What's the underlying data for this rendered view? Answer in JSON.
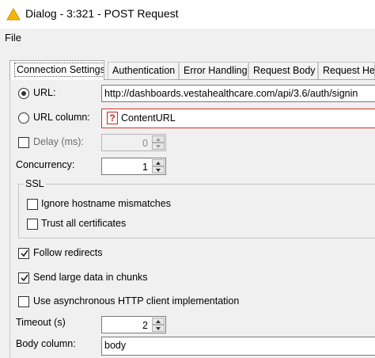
{
  "window": {
    "title": "Dialog - 3:321 - POST Request",
    "icon": "warning-triangle-icon",
    "accent_color": "#f5b800"
  },
  "menu": {
    "file": "File"
  },
  "tabs": [
    {
      "label": "Connection Settings",
      "active": true
    },
    {
      "label": "Authentication",
      "active": false
    },
    {
      "label": "Error Handling",
      "active": false
    },
    {
      "label": "Request Body",
      "active": false
    },
    {
      "label": "Request Hea",
      "active": false
    }
  ],
  "form": {
    "url_label": "URL:",
    "url_value": "http://dashboards.vestahealthcare.com/api/3.6/auth/signin",
    "url_selected": true,
    "url_column_label": "URL column:",
    "url_column_value": "ContentURL",
    "url_column_badge": "?",
    "delay_label": "Delay (ms):",
    "delay_checked": false,
    "delay_value": "0",
    "concurrency_label": "Concurrency:",
    "concurrency_value": "1",
    "ssl_title": "SSL",
    "ignore_hostname_label": "Ignore hostname mismatches",
    "ignore_hostname_checked": false,
    "trust_all_label": "Trust all certificates",
    "trust_all_checked": false,
    "follow_redirects_label": "Follow redirects",
    "follow_redirects_checked": true,
    "send_chunks_label": "Send large data in chunks",
    "send_chunks_checked": true,
    "async_label": "Use asynchronous HTTP client implementation",
    "async_checked": false,
    "timeout_label": "Timeout (s)",
    "timeout_value": "2",
    "body_column_label": "Body column:",
    "body_column_value": "body"
  }
}
